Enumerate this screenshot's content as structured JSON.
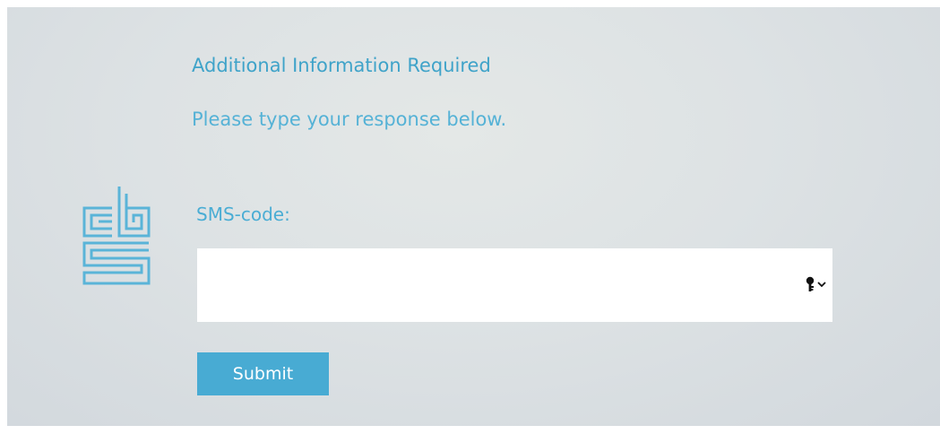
{
  "header": {
    "title": "Additional Information Required",
    "instruction": "Please type your response below."
  },
  "logo": {
    "icon": "cbs-logo-icon"
  },
  "form": {
    "field_label": "SMS-code:",
    "field_value": "",
    "key_icon": "key-icon",
    "dropdown_icon": "chevron-down-icon",
    "submit_label": "Submit"
  },
  "colors": {
    "accent": "#48abd3",
    "text_accent": "#3fa3c9",
    "background": "#dde2e4"
  }
}
